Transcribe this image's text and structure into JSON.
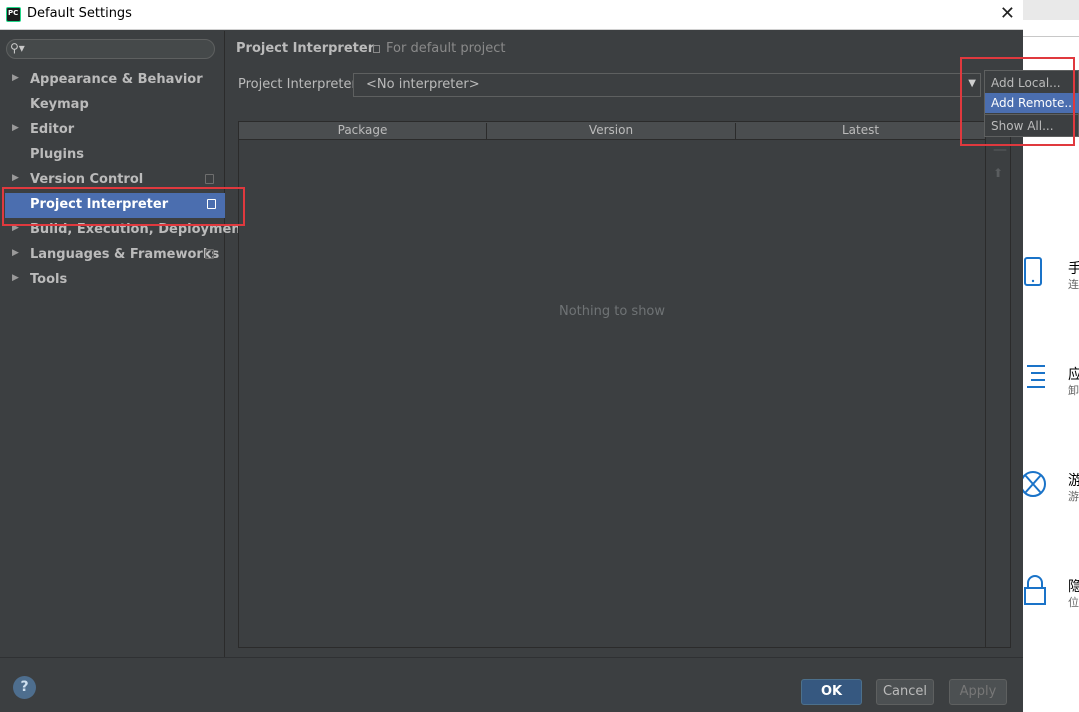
{
  "window": {
    "title": "Default Settings",
    "close_glyph": "✕"
  },
  "sidebar": {
    "search_placeholder": "",
    "items": [
      {
        "label": "Appearance & Behavior",
        "expandable": true
      },
      {
        "label": "Keymap",
        "expandable": false
      },
      {
        "label": "Editor",
        "expandable": true
      },
      {
        "label": "Plugins",
        "expandable": false
      },
      {
        "label": "Version Control",
        "expandable": true,
        "project_icon": true
      },
      {
        "label": "Project Interpreter",
        "expandable": false,
        "project_icon": true,
        "selected": true
      },
      {
        "label": "Build, Execution, Deployment",
        "expandable": true
      },
      {
        "label": "Languages & Frameworks",
        "expandable": true,
        "project_icon": true
      },
      {
        "label": "Tools",
        "expandable": true
      }
    ]
  },
  "main": {
    "breadcrumb": "Project Interpreter",
    "breadcrumb_note": "For default project",
    "interpreter_label": "Project Interpreter:",
    "interpreter_value": "<No interpreter>",
    "table": {
      "columns": [
        "Package",
        "Version",
        "Latest"
      ],
      "empty_text": "Nothing to show"
    }
  },
  "popup_menu": {
    "items": [
      "Add Local...",
      "Add Remote...",
      "Show All..."
    ],
    "selected_index": 1
  },
  "footer": {
    "help": "?",
    "ok": "OK",
    "cancel": "Cancel",
    "apply": "Apply"
  },
  "background_app": {
    "items": [
      {
        "title": "手",
        "subtitle": "连",
        "icon": "phone-icon"
      },
      {
        "title": "应",
        "subtitle": "卸",
        "icon": "list-icon"
      },
      {
        "title": "游",
        "subtitle": "游",
        "icon": "xbox-icon"
      },
      {
        "title": "隐",
        "subtitle": "位",
        "icon": "lock-icon"
      }
    ]
  },
  "colors": {
    "dialog_bg": "#3c3f41",
    "selection": "#4b6eaf",
    "highlight_box": "#e0393e",
    "ok_button": "#365880"
  }
}
